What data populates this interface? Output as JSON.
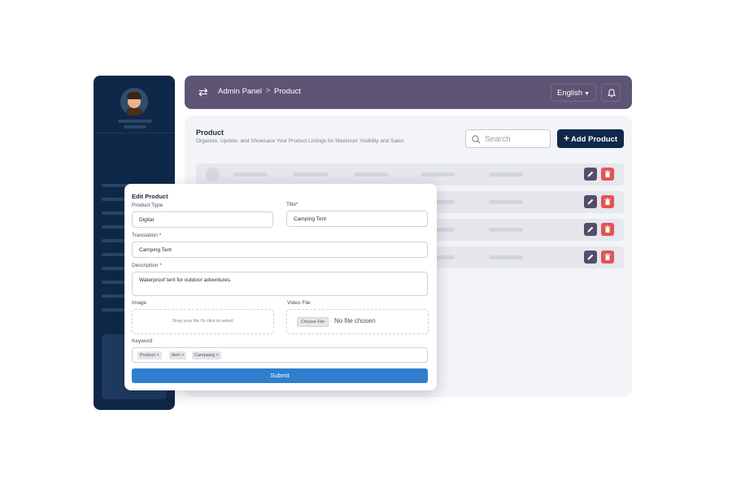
{
  "topbar": {
    "breadcrumb": [
      "Admin Panel",
      "Product"
    ],
    "breadcrumb_separator": ">",
    "language": "English",
    "icons": [
      "swap-icon",
      "bell-icon"
    ]
  },
  "panel": {
    "title": "Product",
    "subtitle": "Organize, Update, and Showcase Your Product Listings for Maximum Visibility and Sales",
    "search_placeholder": "Search",
    "add_button_label": "Add Product",
    "row_count": 4,
    "row_actions": [
      "edit-icon",
      "delete-icon"
    ]
  },
  "modal": {
    "title": "Edit  Product",
    "product_type": {
      "label": "Product Type",
      "value": "Digital"
    },
    "title_field": {
      "label": "Title*",
      "value": "Camping Tent"
    },
    "translation": {
      "label": "Translation *",
      "value": "Camping Tent"
    },
    "description": {
      "label": "Description *",
      "value": "Waterproof tent for outdoor adventures."
    },
    "image": {
      "label": "Image",
      "drop_text": "Drop your file Or click to select"
    },
    "video_file": {
      "label": "Video File",
      "button_label": "Choose File",
      "status": "No file chosen"
    },
    "keyword": {
      "label": "Keyword",
      "tags": [
        "Product ×",
        "Item ×",
        "Campaing ×"
      ]
    },
    "submit_label": "Submit"
  },
  "colors": {
    "sidebar": "#0f2748",
    "topbar": "#5e5575",
    "primary_button": "#0f2748",
    "submit": "#2f7fce",
    "edit_action": "#574d6a",
    "delete_action": "#e25454"
  }
}
